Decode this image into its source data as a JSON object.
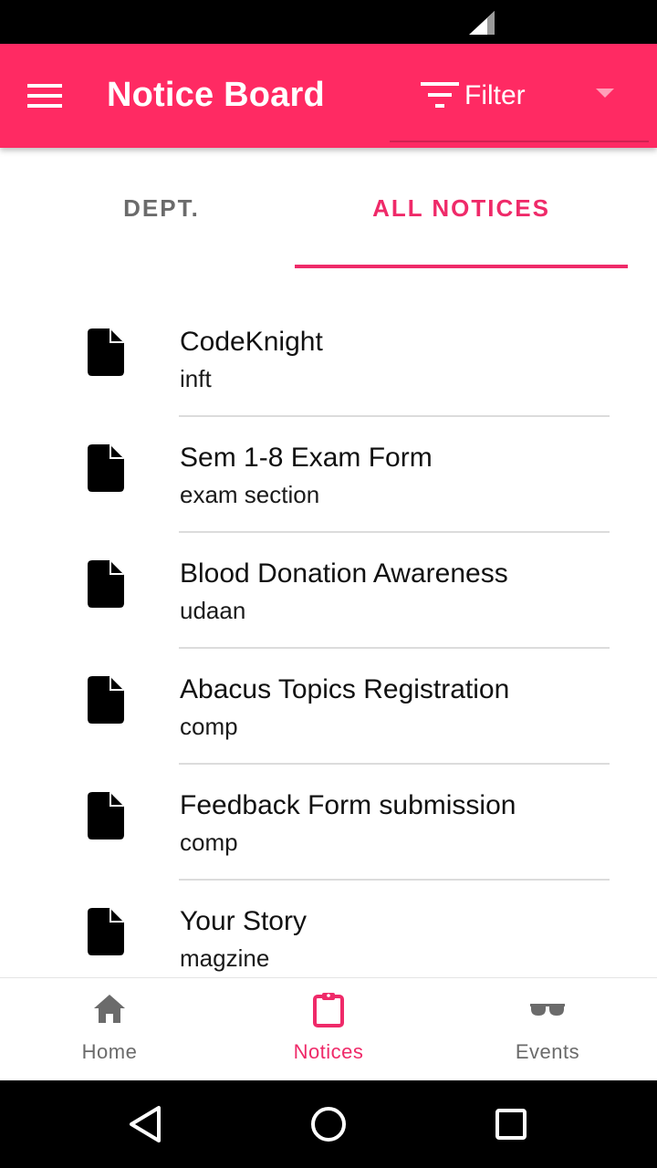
{
  "status_bar": {
    "icons": [
      "signal-icon"
    ]
  },
  "app_bar": {
    "title": "Notice Board",
    "menu_icon": "hamburger-menu-icon",
    "filter": {
      "label": "Filter",
      "icon": "filter-icon",
      "caret_icon": "dropdown-caret-icon"
    },
    "background_color": "#ff2a63"
  },
  "tabs": [
    {
      "label": "DEPT.",
      "selected": false
    },
    {
      "label": "ALL NOTICES",
      "selected": true
    }
  ],
  "accent_color": "#ef2a69",
  "notices": [
    {
      "title": "CodeKnight",
      "department": "inft",
      "icon": "document-icon"
    },
    {
      "title": "Sem 1-8 Exam Form",
      "department": "exam section",
      "icon": "document-icon"
    },
    {
      "title": "Blood Donation Awareness",
      "department": "udaan",
      "icon": "document-icon"
    },
    {
      "title": "Abacus Topics Registration",
      "department": "comp",
      "icon": "document-icon"
    },
    {
      "title": "Feedback Form submission",
      "department": "comp",
      "icon": "document-icon"
    },
    {
      "title": "Your Story",
      "department": "magzine",
      "icon": "document-icon"
    }
  ],
  "bottom_nav": [
    {
      "label": "Home",
      "icon": "home-icon",
      "selected": false
    },
    {
      "label": "Notices",
      "icon": "clipboard-icon",
      "selected": true
    },
    {
      "label": "Events",
      "icon": "sunglasses-icon",
      "selected": false
    }
  ],
  "system_nav": {
    "buttons": [
      "back-icon",
      "home-circle-icon",
      "recents-icon"
    ]
  }
}
